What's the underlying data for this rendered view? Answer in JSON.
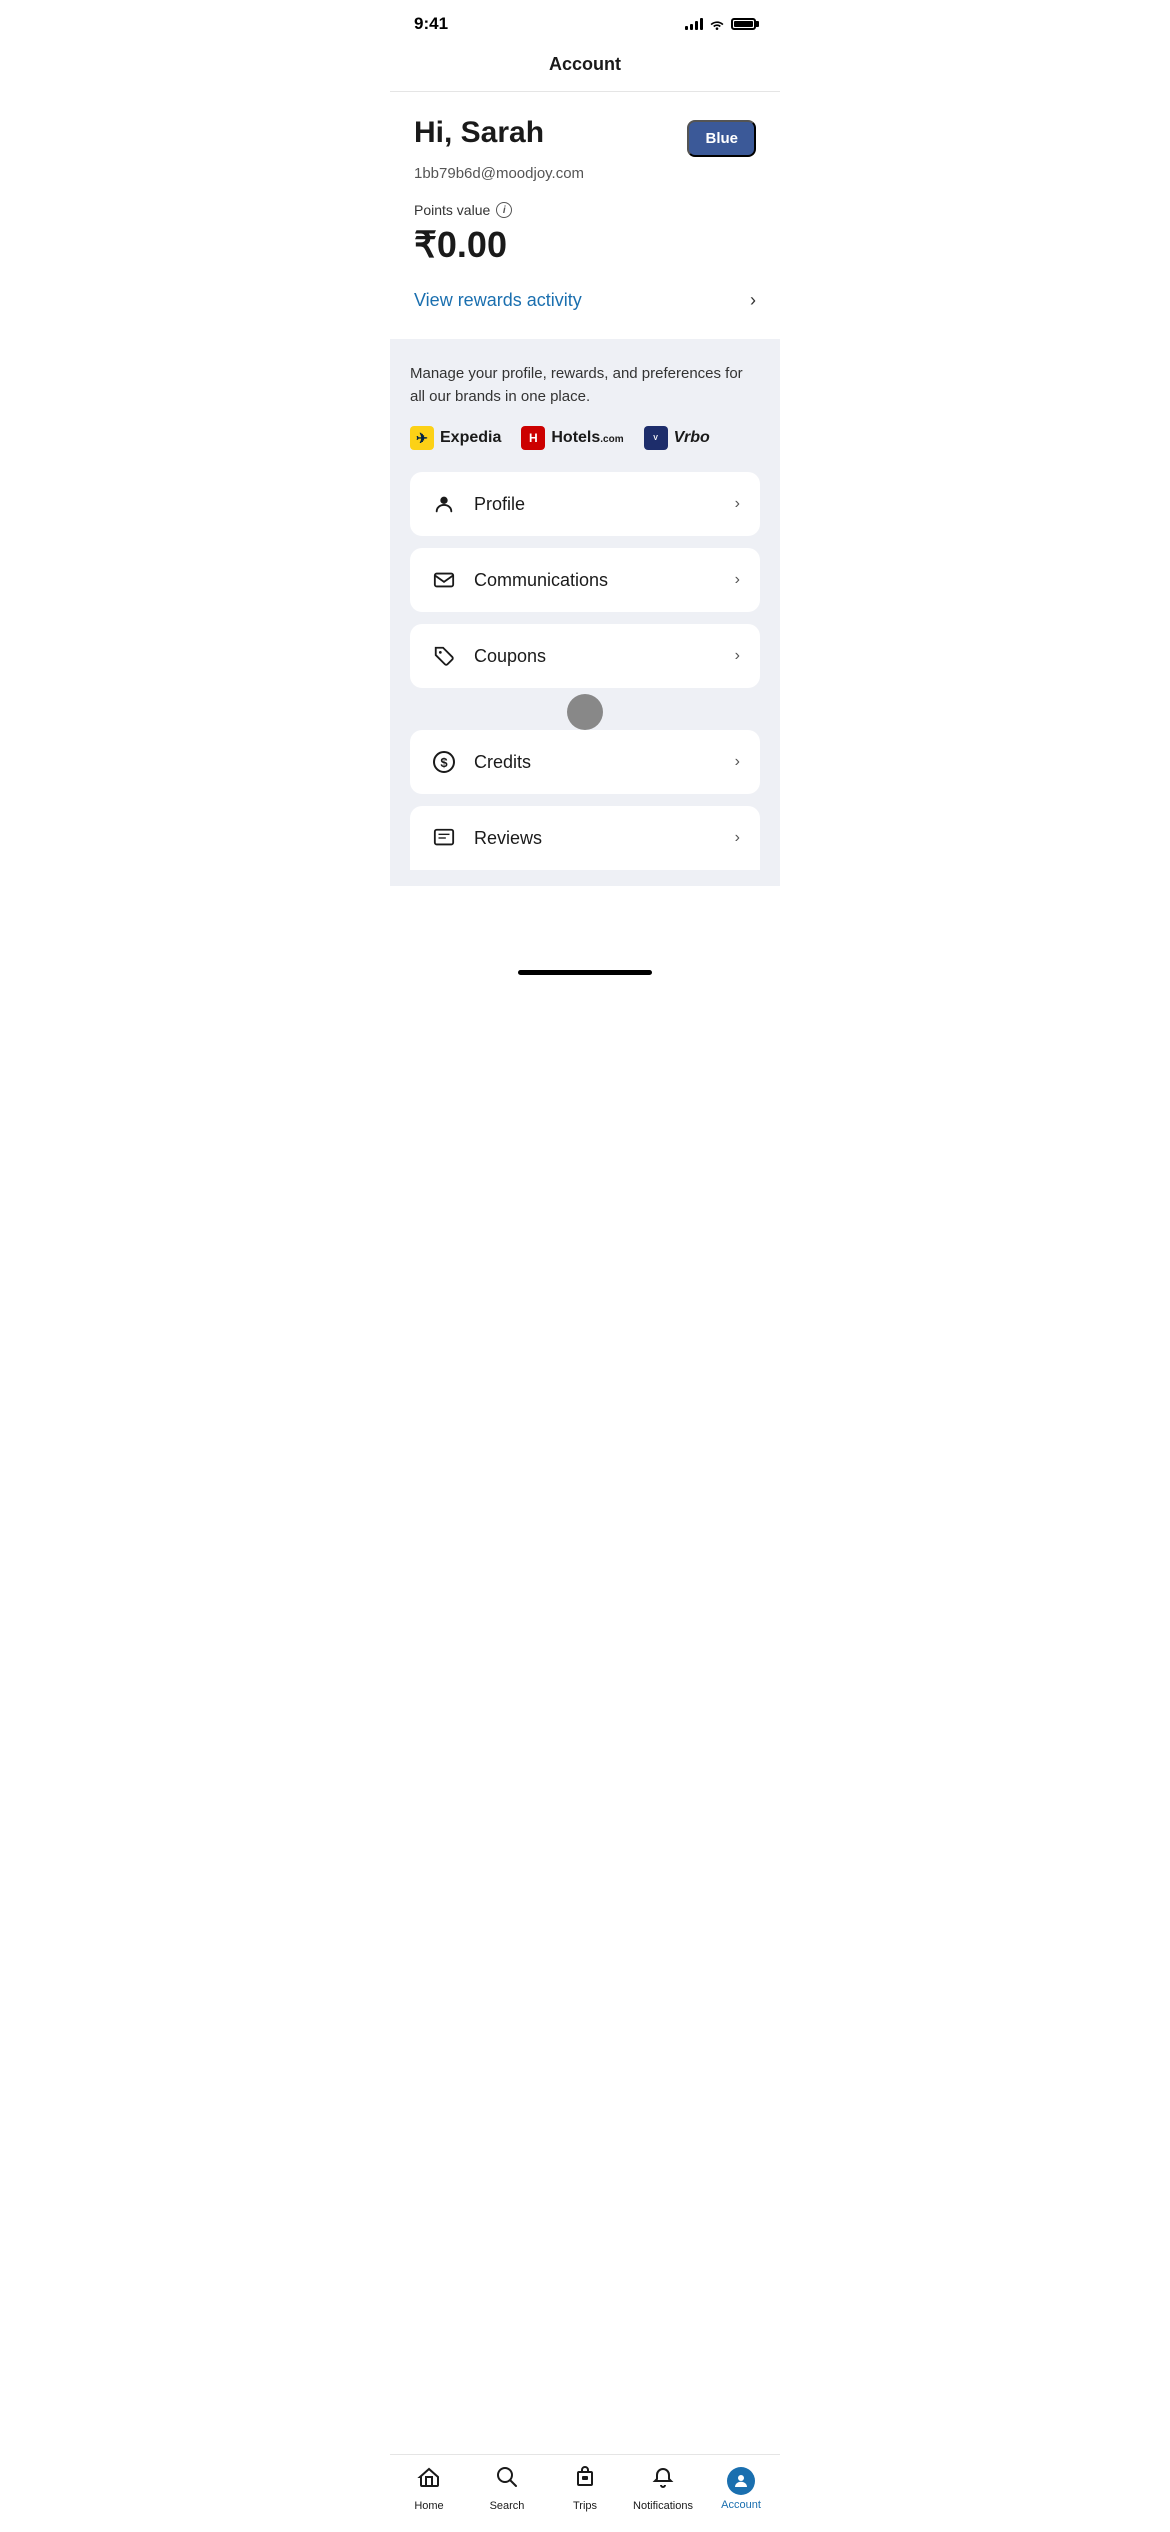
{
  "status": {
    "time": "9:41"
  },
  "header": {
    "title": "Account"
  },
  "user": {
    "greeting": "Hi, Sarah",
    "email": "1bb79b6d@moodjoy.com",
    "badge": "Blue",
    "points_label": "Points value",
    "points_value": "₹0.00",
    "rewards_link": "View rewards activity"
  },
  "manage_section": {
    "description": "Manage your profile, rewards, and preferences for all our brands in one place.",
    "brands": [
      {
        "id": "expedia",
        "name": "Expedia"
      },
      {
        "id": "hotels",
        "name": "Hotels.com"
      },
      {
        "id": "vrbo",
        "name": "Vrbo"
      }
    ]
  },
  "menu_items": [
    {
      "id": "profile",
      "label": "Profile",
      "icon": "person"
    },
    {
      "id": "communications",
      "label": "Communications",
      "icon": "mail"
    },
    {
      "id": "coupons",
      "label": "Coupons",
      "icon": "tag"
    },
    {
      "id": "credits",
      "label": "Credits",
      "icon": "dollar"
    },
    {
      "id": "reviews",
      "label": "Reviews",
      "icon": "star"
    }
  ],
  "bottom_nav": [
    {
      "id": "home",
      "label": "Home",
      "icon": "home",
      "active": false
    },
    {
      "id": "search",
      "label": "Search",
      "icon": "search",
      "active": false
    },
    {
      "id": "trips",
      "label": "Trips",
      "icon": "trips",
      "active": false
    },
    {
      "id": "notifications",
      "label": "Notifications",
      "icon": "bell",
      "active": false
    },
    {
      "id": "account",
      "label": "Account",
      "icon": "account",
      "active": true
    }
  ]
}
